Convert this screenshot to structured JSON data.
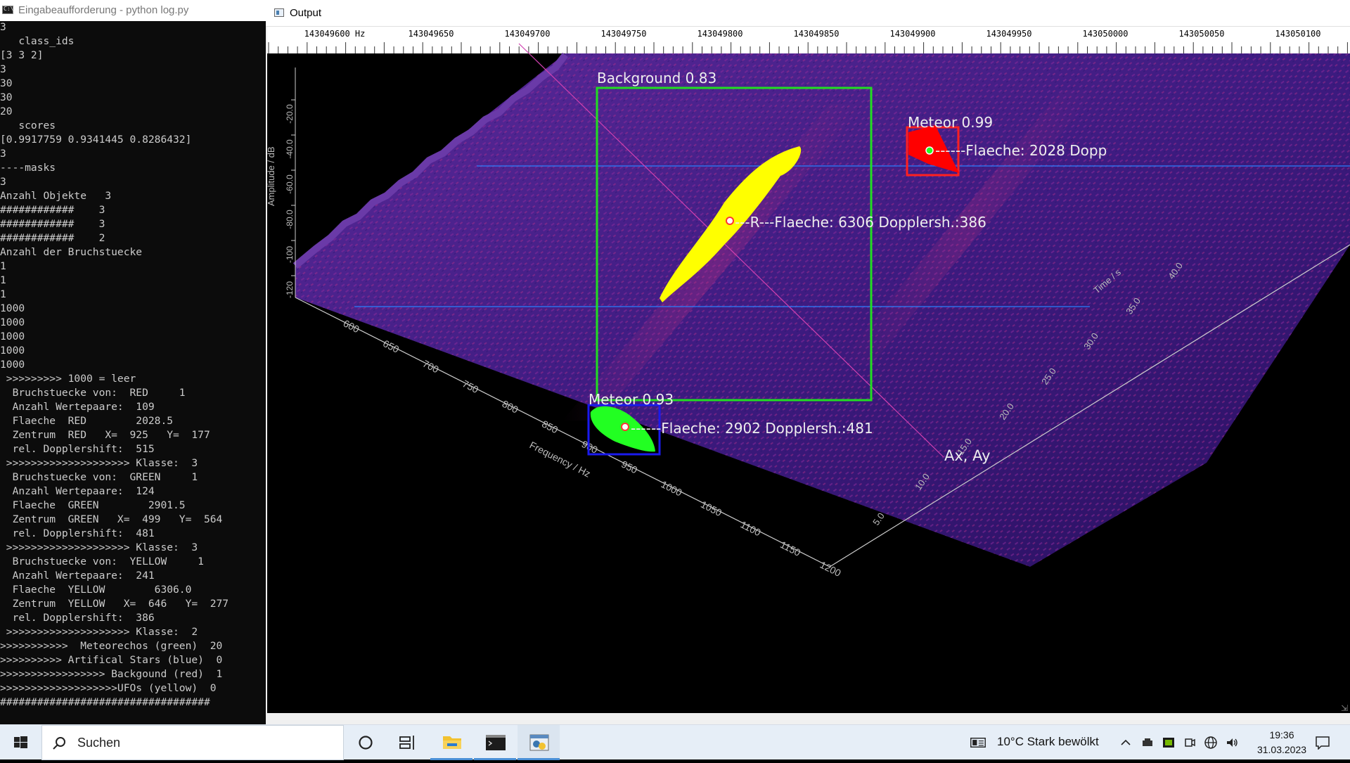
{
  "console": {
    "title": "Eingabeaufforderung - python  log.py",
    "lines": [
      "3",
      "   class_ids",
      "[3 3 2]",
      "3",
      "30",
      "30",
      "20",
      "   scores",
      "[0.9917759 0.9341445 0.8286432]",
      "3",
      "----masks",
      "3",
      "Anzahl Objekte   3",
      "############    3",
      "############    3",
      "############    2",
      "Anzahl der Bruchstuecke",
      "1",
      "1",
      "1",
      "1000",
      "1000",
      "1000",
      "1000",
      "1000",
      " >>>>>>>>> 1000 = leer",
      "  Bruchstuecke von:  RED     1",
      "  Anzahl Wertepaare:  109",
      "  Flaeche  RED        2028.5",
      "  Zentrum  RED   X=  925   Y=  177",
      "  rel. Dopplershift:  515",
      " >>>>>>>>>>>>>>>>>>>> Klasse:  3",
      "  Bruchstuecke von:  GREEN     1",
      "  Anzahl Wertepaare:  124",
      "  Flaeche  GREEN        2901.5",
      "  Zentrum  GREEN   X=  499   Y=  564",
      "  rel. Dopplershift:  481",
      " >>>>>>>>>>>>>>>>>>>> Klasse:  3",
      "  Bruchstuecke von:  YELLOW     1",
      "  Anzahl Wertepaare:  241",
      "  Flaeche  YELLOW        6306.0",
      "  Zentrum  YELLOW   X=  646   Y=  277",
      "  rel. Dopplershift:  386",
      " >>>>>>>>>>>>>>>>>>>> Klasse:  2",
      ">>>>>>>>>>>  Meteorechos (green)  20",
      ">>>>>>>>>> Artifical Stars (blue)  0",
      ">>>>>>>>>>>>>>>>> Backgound (red)  1",
      ">>>>>>>>>>>>>>>>>>>UFOs (yellow)  0",
      "##################################"
    ]
  },
  "output": {
    "title": "Output",
    "ruler_labels": [
      "143049600 Hz",
      "143049650",
      "143049700",
      "143049750",
      "143049800",
      "143049850",
      "143049900",
      "143049950",
      "143050000",
      "143050050",
      "143050100"
    ],
    "amplitude_axis": {
      "label": "Amplitude / dB",
      "ticks": [
        "-20.0",
        "-40.0",
        "-60.0",
        "-80.0",
        "-100",
        "-120"
      ]
    },
    "frequency_axis": {
      "label": "Frequency / Hz",
      "ticks": [
        "600",
        "650",
        "700",
        "750",
        "800",
        "850",
        "900",
        "950",
        "1000",
        "1050",
        "1100",
        "1150",
        "1200"
      ]
    },
    "time_axis": {
      "label": "Time / s",
      "ticks": [
        "5.0",
        "10.0",
        "15.0",
        "20.0",
        "25.0",
        "30.0",
        "35.0",
        "40.0"
      ]
    },
    "corner_label": "Ax, Ay",
    "detections": [
      {
        "label": "Background 0.83",
        "color": "#22dd22",
        "class": "Background",
        "score": 0.83
      },
      {
        "label": "Meteor 0.99",
        "color": "#ff2020",
        "class": "Meteor",
        "score": 0.99,
        "mask_color": "#ff0000",
        "annotation": "------Flaeche: 2028 Dopp"
      },
      {
        "label": "Meteor 0.93",
        "color": "#1a1aee",
        "class": "Meteor",
        "score": 0.93,
        "mask_color": "#22ff22",
        "annotation": "------Flaeche: 2902 Dopplersh.:481"
      }
    ],
    "yellow_annotation": "---R---Flaeche: 6306 Dopplersh.:386",
    "colors": {
      "waterfall_low": "#3a1a7a",
      "waterfall_high": "#b0208a",
      "guide_line": "#2a7fff",
      "diagonal": "#d040b0"
    }
  },
  "taskbar": {
    "search_placeholder": "Suchen",
    "weather": "10°C  Stark bewölkt",
    "time": "19:36",
    "date": "31.03.2023",
    "apps": [
      {
        "name": "cortana",
        "icon": "circle-icon"
      },
      {
        "name": "task-view",
        "icon": "task-view-icon"
      },
      {
        "name": "file-explorer",
        "icon": "folder-icon"
      },
      {
        "name": "command-prompt",
        "icon": "terminal-icon"
      },
      {
        "name": "python",
        "icon": "python-icon"
      }
    ]
  }
}
